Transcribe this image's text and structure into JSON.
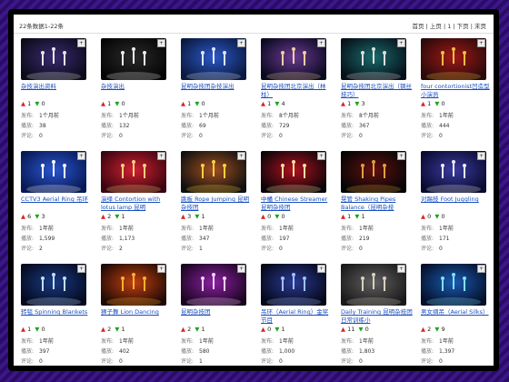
{
  "header": {
    "count_text": "22条数据1-22条",
    "pager": [
      "首页",
      "上页",
      "1",
      "下页",
      "末页"
    ]
  },
  "labels": {
    "published": "发布:",
    "plays": "播放:",
    "comments": "评论:"
  },
  "videos": [
    {
      "title": "杂技演出资料",
      "up": "1",
      "down": "0",
      "published": "1个月前",
      "plays": "38",
      "comments": "0",
      "colors": [
        "#0b0b1a",
        "#3a2a70",
        "#e8e8e8"
      ]
    },
    {
      "title": "杂技演出",
      "up": "1",
      "down": "0",
      "published": "1个月前",
      "plays": "132",
      "comments": "0",
      "colors": [
        "#050505",
        "#2a2a2a",
        "#f0f0f0"
      ]
    },
    {
      "title": "昆明杂技团杂技演出",
      "up": "1",
      "down": "0",
      "published": "1个月前",
      "plays": "69",
      "comments": "0",
      "colors": [
        "#0a1a40",
        "#2c58c8",
        "#dfe8ff"
      ]
    },
    {
      "title": "昆明杂技团北京演出（林柱）",
      "up": "1",
      "down": "4",
      "published": "8个月前",
      "plays": "729",
      "comments": "0",
      "colors": [
        "#0a0a20",
        "#6a3a90",
        "#f5d0a0"
      ]
    },
    {
      "title": "昆明杂技团北京演出（钢丝技巧）",
      "up": "1",
      "down": "3",
      "published": "8个月前",
      "plays": "367",
      "comments": "0",
      "colors": [
        "#06101a",
        "#1a6a6a",
        "#e0e0e0"
      ]
    },
    {
      "title": "four contortionist凹造型小演员",
      "up": "1",
      "down": "0",
      "published": "1年前",
      "plays": "444",
      "comments": "0",
      "colors": [
        "#2a0a0a",
        "#a01818",
        "#f0c040"
      ]
    },
    {
      "title": "CCTV3 Aerial Ring 吊环",
      "up": "6",
      "down": "3",
      "published": "1年前",
      "plays": "1,599",
      "comments": "2",
      "colors": [
        "#081a55",
        "#2a55d0",
        "#ffffff"
      ]
    },
    {
      "title": "演绎 Contortion with lotus lamp 昆明",
      "up": "2",
      "down": "1",
      "published": "1年前",
      "plays": "1,173",
      "comments": "2",
      "colors": [
        "#3a0510",
        "#d02030",
        "#ffd080"
      ]
    },
    {
      "title": "跳板 Rope Jumping 昆明杂技团",
      "up": "3",
      "down": "1",
      "published": "1年前",
      "plays": "347",
      "comments": "1",
      "colors": [
        "#101010",
        "#a05020",
        "#ffd040"
      ]
    },
    {
      "title": "中幡 Chinese Streamer 昆明杂技团",
      "up": "0",
      "down": "0",
      "published": "1年前",
      "plays": "197",
      "comments": "0",
      "colors": [
        "#0a0508",
        "#b01020",
        "#ffe0a0"
      ]
    },
    {
      "title": "晃管 Shaking Pipes Balance（昆明杂技",
      "up": "1",
      "down": "1",
      "published": "1年前",
      "plays": "219",
      "comments": "0",
      "colors": [
        "#050505",
        "#601010",
        "#e0a040"
      ]
    },
    {
      "title": "对踢技 Foot Juggling",
      "up": "0",
      "down": "0",
      "published": "1年前",
      "plays": "171",
      "comments": "0",
      "colors": [
        "#0a0a30",
        "#3a3aa0",
        "#f0f0f0"
      ]
    },
    {
      "title": "转毯 Spinning Blankets",
      "up": "1",
      "down": "0",
      "published": "1年前",
      "plays": "397",
      "comments": "0",
      "colors": [
        "#050a20",
        "#1a3a80",
        "#c0e0ff"
      ]
    },
    {
      "title": "狮子舞 Lion Dancing",
      "up": "2",
      "down": "1",
      "published": "1年前",
      "plays": "402",
      "comments": "0",
      "colors": [
        "#200a05",
        "#c04010",
        "#ffb030"
      ]
    },
    {
      "title": "昆明杂技团",
      "up": "2",
      "down": "1",
      "published": "1年前",
      "plays": "580",
      "comments": "1",
      "colors": [
        "#1a0520",
        "#8a20a0",
        "#ffd0ff"
      ]
    },
    {
      "title": "吊环（Aerial Ring）金奖节目",
      "up": "0",
      "down": "1",
      "published": "1年前",
      "plays": "1,000",
      "comments": "0",
      "colors": [
        "#05081a",
        "#2a3a90",
        "#a0c0ff"
      ]
    },
    {
      "title": "Daily Training 昆明杂技团日常训练小",
      "up": "11",
      "down": "0",
      "published": "1年前",
      "plays": "1,803",
      "comments": "0",
      "colors": [
        "#1a1a1a",
        "#606060",
        "#d8d0c0"
      ]
    },
    {
      "title": "男女绸吊（Aerial Silks）",
      "up": "2",
      "down": "9",
      "published": "1年前",
      "plays": "1,397",
      "comments": "0",
      "colors": [
        "#05102a",
        "#1a5ab0",
        "#80e0ff"
      ]
    }
  ]
}
